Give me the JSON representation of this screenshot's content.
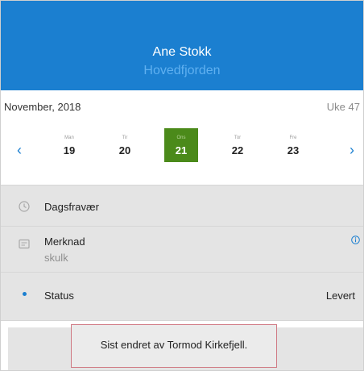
{
  "header": {
    "name": "Ane Stokk",
    "subtitle": "Hovedfjorden",
    "color": "#1b7fd0"
  },
  "calendar": {
    "month": "November, 2018",
    "week": "Uke 47",
    "prev_icon": "chevron-left-icon",
    "next_icon": "chevron-right-icon",
    "days": [
      {
        "name": "Man",
        "date": "19",
        "selected": false
      },
      {
        "name": "Tir",
        "date": "20",
        "selected": false
      },
      {
        "name": "Ons",
        "date": "21",
        "selected": true
      },
      {
        "name": "Tor",
        "date": "22",
        "selected": false
      },
      {
        "name": "Fre",
        "date": "23",
        "selected": false
      }
    ],
    "selected_color": "#4b8a1a"
  },
  "rows": {
    "absence": {
      "label": "Dagsfravær",
      "icon": "clock-icon"
    },
    "note": {
      "label": "Merknad",
      "value": "skulk",
      "icon": "note-icon",
      "info_icon": "info-icon"
    },
    "status": {
      "label": "Status",
      "value": "Levert",
      "icon": "dot-icon"
    }
  },
  "toast": {
    "text": "Sist endret av Tormod Kirkefjell."
  }
}
